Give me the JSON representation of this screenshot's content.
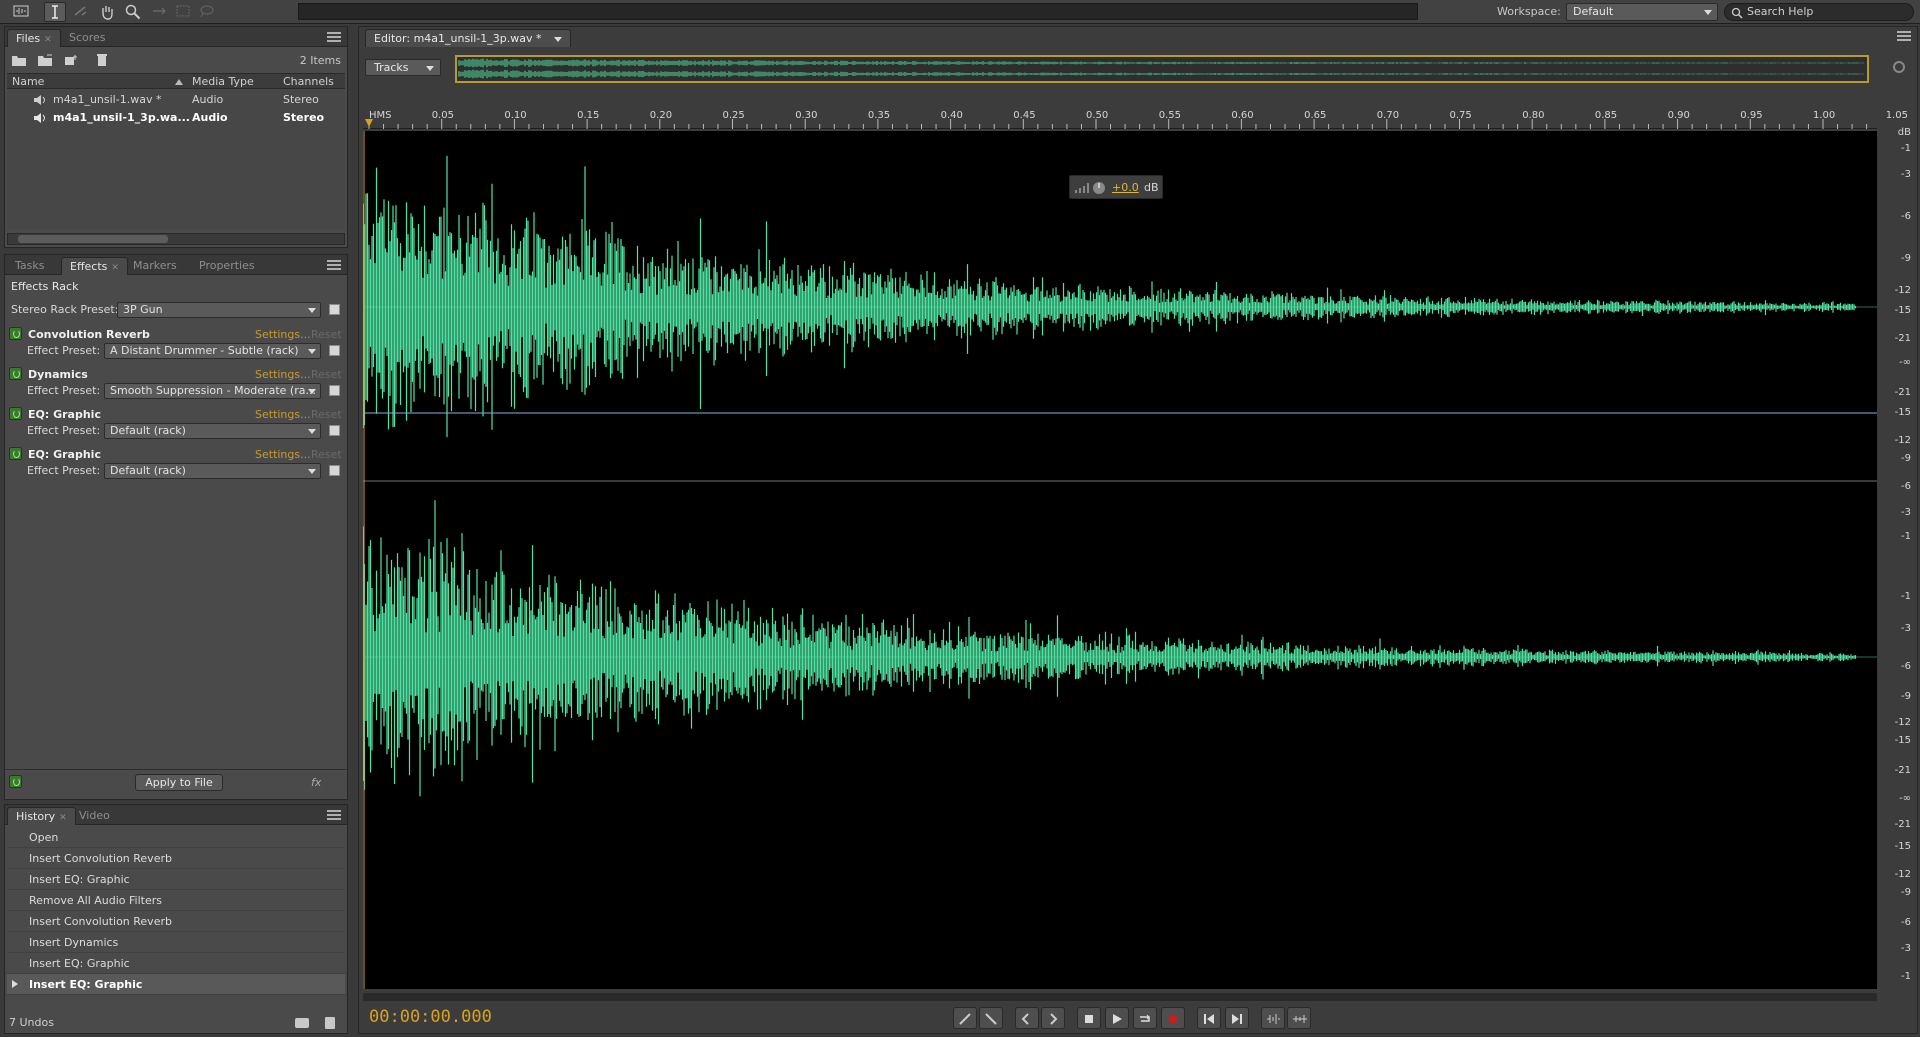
{
  "workspace": {
    "label": "Workspace:",
    "value": "Default"
  },
  "search": {
    "placeholder": "Search Help"
  },
  "files": {
    "tabs": [
      "Files",
      "Scores"
    ],
    "count": "2 Items",
    "columns": [
      "Name",
      "Media Type",
      "Channels"
    ],
    "rows": [
      {
        "name": "m4a1_unsil-1.wav *",
        "type": "Audio",
        "channels": "Stereo"
      },
      {
        "name": "m4a1_unsil-1_3p.wa...",
        "type": "Audio",
        "channels": "Stereo"
      }
    ]
  },
  "effects": {
    "tabs": [
      "Tasks",
      "Effects",
      "Markers",
      "Properties"
    ],
    "rack_title": "Effects Rack",
    "preset_label": "Stereo Rack Preset:",
    "preset_value": "3P Gun",
    "effect_preset_label": "Effect Preset:",
    "settings_label": "Settings...",
    "reset_label": "Reset",
    "items": [
      {
        "name": "Convolution Reverb",
        "preset": "A Distant Drummer - Subtle (rack)"
      },
      {
        "name": "Dynamics",
        "preset": "Smooth Suppression - Moderate (ra..."
      },
      {
        "name": "EQ: Graphic",
        "preset": "Default (rack)"
      },
      {
        "name": "EQ: Graphic",
        "preset": "Default (rack)"
      }
    ],
    "apply_label": "Apply to File",
    "fx_label": "fx"
  },
  "history": {
    "tabs": [
      "History",
      "Video"
    ],
    "items": [
      "Open",
      "Insert Convolution Reverb",
      "Insert EQ: Graphic",
      "Remove All Audio Filters",
      "Insert Convolution Reverb",
      "Insert Dynamics",
      "Insert EQ: Graphic",
      "Insert EQ: Graphic"
    ],
    "undos": "7 Undos"
  },
  "editor": {
    "tab": "Editor: m4a1_unsil-1_3p.wav *",
    "tracks": "Tracks",
    "gain_value": "+0.0",
    "gain_unit": "dB",
    "timecode": "00:00:00.000",
    "ruler_start": "HMS",
    "ruler_labels": [
      "0.05",
      "0.10",
      "0.15",
      "0.20",
      "0.25",
      "0.30",
      "0.35",
      "0.40",
      "0.45",
      "0.50",
      "0.55",
      "0.60",
      "0.65",
      "0.70",
      "0.75",
      "0.80",
      "0.85",
      "0.90",
      "0.95",
      "1.00",
      "1.05"
    ],
    "db_unit": "dB",
    "db_top": [
      "-1",
      "-3",
      "-6",
      "-9",
      "-12",
      "-15",
      "-21",
      "-∞",
      "-21",
      "-15",
      "-12",
      "-9",
      "-6",
      "-3",
      "-1"
    ],
    "db_bottom": [
      "-1",
      "-3",
      "-6",
      "-9",
      "-12",
      "-15",
      "-21",
      "-∞",
      "-21",
      "-15",
      "-12",
      "-9",
      "-6",
      "-3",
      "-1"
    ]
  },
  "colors": {
    "waveform": "#4fe3a3",
    "accent": "#d8a21e",
    "background": "#000000"
  }
}
